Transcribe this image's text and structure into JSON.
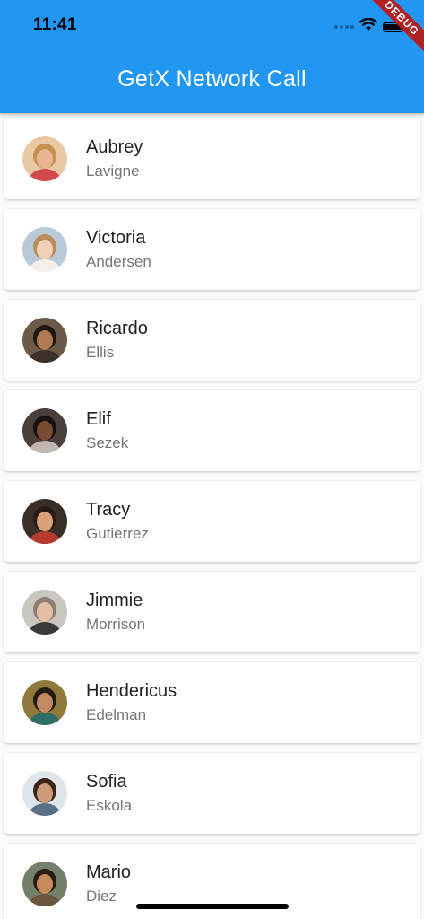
{
  "status_bar": {
    "time": "11:41",
    "icons": [
      "signal-dots-icon",
      "wifi-icon",
      "battery-icon"
    ]
  },
  "debug_banner": "DEBUG",
  "app_bar": {
    "title": "GetX Network Call",
    "color": "#2196f3"
  },
  "users": [
    {
      "first_name": "Aubrey",
      "last_name": "Lavigne",
      "avatar": {
        "bg": "#e9c8a4",
        "skin": "#e8b592",
        "hair": "#c6904f",
        "shirt": "#d44a4a"
      }
    },
    {
      "first_name": "Victoria",
      "last_name": "Andersen",
      "avatar": {
        "bg": "#b9c9d8",
        "skin": "#f1d0b8",
        "hair": "#b98c5a",
        "shirt": "#f4efe9"
      }
    },
    {
      "first_name": "Ricardo",
      "last_name": "Ellis",
      "avatar": {
        "bg": "#6b5a48",
        "skin": "#b07a52",
        "hair": "#1e1712",
        "shirt": "#3b3128"
      }
    },
    {
      "first_name": "Elif",
      "last_name": "Sezek",
      "avatar": {
        "bg": "#4a3f3a",
        "skin": "#7b4a32",
        "hair": "#171111",
        "shirt": "#c0b7b0"
      }
    },
    {
      "first_name": "Tracy",
      "last_name": "Gutierrez",
      "avatar": {
        "bg": "#3a2f26",
        "skin": "#d9a079",
        "hair": "#2a1c14",
        "shirt": "#b73a2e"
      }
    },
    {
      "first_name": "Jimmie",
      "last_name": "Morrison",
      "avatar": {
        "bg": "#c9c5c0",
        "skin": "#e3bfa6",
        "hair": "#8e7f73",
        "shirt": "#3c3a3a"
      }
    },
    {
      "first_name": "Hendericus",
      "last_name": "Edelman",
      "avatar": {
        "bg": "#8f7a3c",
        "skin": "#c48a62",
        "hair": "#231b15",
        "shirt": "#2f6d67"
      }
    },
    {
      "first_name": "Sofia",
      "last_name": "Eskola",
      "avatar": {
        "bg": "#dfe4e8",
        "skin": "#cf9c7a",
        "hair": "#3a2519",
        "shirt": "#5a6f88"
      }
    },
    {
      "first_name": "Mario",
      "last_name": "Diez",
      "avatar": {
        "bg": "#75806a",
        "skin": "#c68a5d",
        "hair": "#2b1d14",
        "shirt": "#6a5540"
      }
    }
  ]
}
